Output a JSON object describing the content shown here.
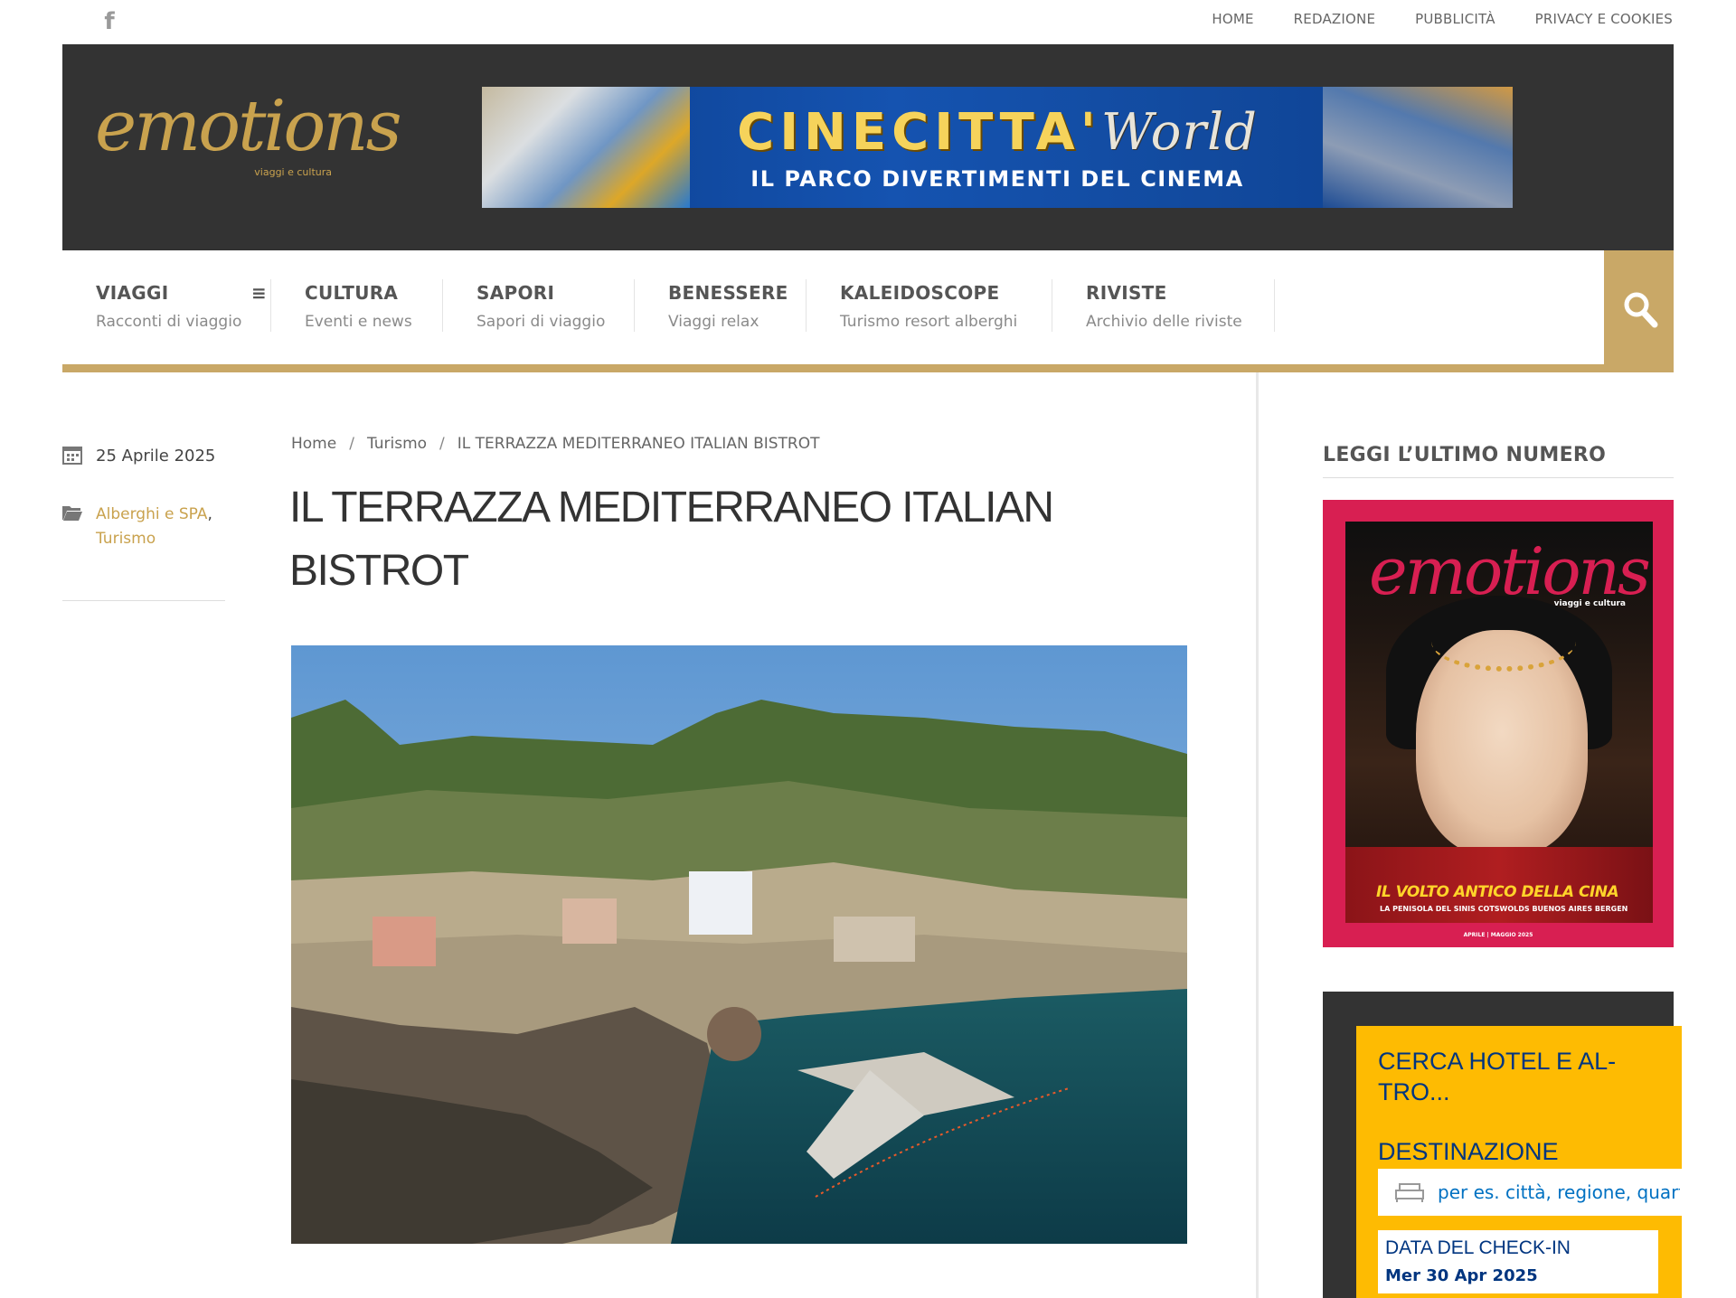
{
  "topbar": {
    "links": [
      "HOME",
      "REDAZIONE",
      "PUBBLICITÀ",
      "PRIVACY E COOKIES"
    ]
  },
  "logo": {
    "word": "emotions",
    "tagline": "viaggi e cultura"
  },
  "banner": {
    "title_a": "CINECITTA'",
    "title_b": "World",
    "subtitle": "IL PARCO DIVERTIMENTI DEL CINEMA"
  },
  "nav": {
    "items": [
      {
        "label": "VIAGGI",
        "sub": "Racconti di viaggio"
      },
      {
        "label": "CULTURA",
        "sub": "Eventi e news"
      },
      {
        "label": "SAPORI",
        "sub": "Sapori di viaggio"
      },
      {
        "label": "BENESSERE",
        "sub": "Viaggi relax"
      },
      {
        "label": "KALEIDOSCOPE",
        "sub": "Turismo resort alberghi"
      },
      {
        "label": "RIVISTE",
        "sub": "Archivio delle riviste"
      }
    ]
  },
  "meta": {
    "date": "25 Aprile 2025",
    "categories": [
      "Alberghi e SPA",
      "Turismo"
    ]
  },
  "article": {
    "breadcrumb": [
      "Home",
      "Turismo",
      "IL TERRAZZA MEDITERRANEO ITALIAN BISTROT"
    ],
    "title": "IL TERRAZZA MEDITERRANEO ITALIAN BISTROT"
  },
  "sidebar": {
    "title": "LEGGI L’ULTIMO NUMERO",
    "cover": {
      "logo": "emotions",
      "tagline": "viaggi e cultura",
      "headline": "IL VOLTO ANTICO DELLA CINA",
      "strapline": "LA PENISOLA DEL SINIS COTSWOLDS BUENOS AIRES BERGEN",
      "issue": "APRILE | MAGGIO 2025"
    },
    "hotel": {
      "title": "CERCA HOTEL E AL-TRO...",
      "dest_label": "DESTINAZIONE",
      "dest_placeholder": "per es. città, regione, quartiere",
      "checkin_label": "DATA DEL CHECK-IN",
      "checkin_value": "Mer 30 Apr 2025"
    }
  },
  "colors": {
    "gold": "#c9a867",
    "header": "#333333",
    "hotel_yellow": "#febb02",
    "hotel_blue": "#003580",
    "cover_pink": "#d81f52"
  }
}
